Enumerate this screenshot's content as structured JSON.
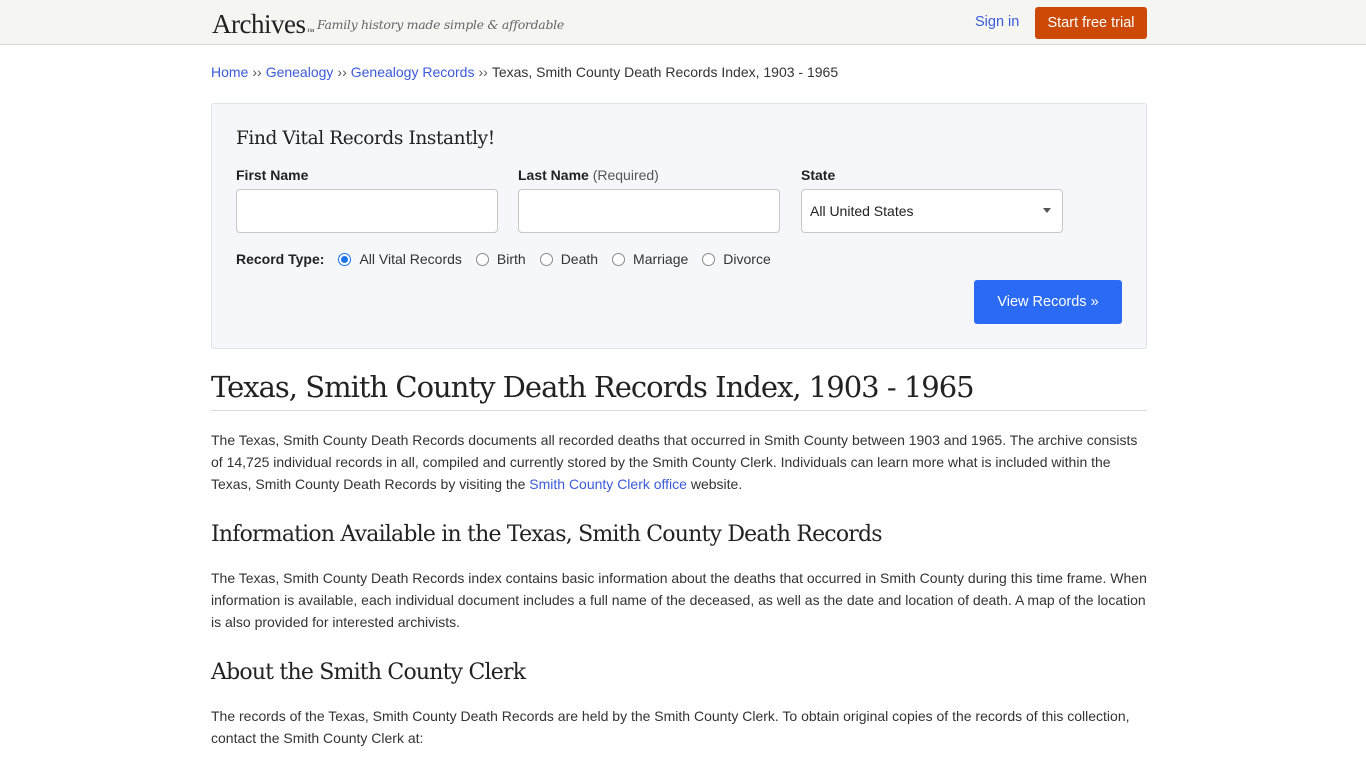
{
  "header": {
    "logo": "Archives",
    "logo_mark": "™",
    "tagline": "Family history made simple & affordable",
    "sign_in": "Sign in",
    "start_trial": "Start free trial",
    "trial_color": "#cc4a06"
  },
  "breadcrumb": {
    "items": [
      "Home",
      "Genealogy",
      "Genealogy Records"
    ],
    "separator": "››",
    "current": "Texas, Smith County Death Records Index, 1903 - 1965"
  },
  "search": {
    "title": "Find Vital Records Instantly!",
    "first_name_label": "First Name",
    "first_name_value": "",
    "last_name_label": "Last Name",
    "last_name_required": "(Required)",
    "last_name_value": "",
    "state_label": "State",
    "state_selected": "All United States",
    "record_type_label": "Record Type:",
    "record_types": [
      {
        "label": "All Vital Records",
        "checked": true
      },
      {
        "label": "Birth",
        "checked": false
      },
      {
        "label": "Death",
        "checked": false
      },
      {
        "label": "Marriage",
        "checked": false
      },
      {
        "label": "Divorce",
        "checked": false
      }
    ],
    "submit_label": "View Records »",
    "submit_color": "#2a6af5"
  },
  "content": {
    "title": "Texas, Smith County Death Records Index, 1903 - 1965",
    "intro_before_link": "The Texas, Smith County Death Records documents all recorded deaths that occurred in Smith County between 1903 and 1965. The archive consists of 14,725 individual records in all, compiled and currently stored by the Smith County Clerk. Individuals can learn more what is included within the Texas, Smith County Death Records by visiting the ",
    "intro_link": "Smith County Clerk office",
    "intro_after_link": " website.",
    "section1_heading": "Information Available in the Texas, Smith County Death Records",
    "section1_text": "The Texas, Smith County Death Records index contains basic information about the deaths that occurred in Smith County during this time frame. When information is available, each individual document includes a full name of the deceased, as well as the date and location of death. A map of the location is also provided for interested archivists.",
    "section2_heading": "About the Smith County Clerk",
    "section2_text": "The records of the Texas, Smith County Death Records are held by the Smith County Clerk. To obtain original copies of the records of this collection, contact the Smith County Clerk at:"
  }
}
